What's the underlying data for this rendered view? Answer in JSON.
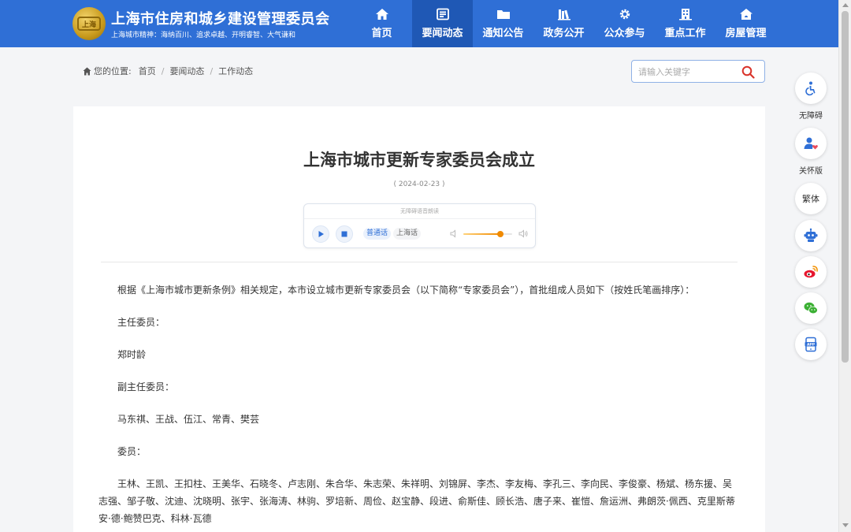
{
  "header": {
    "logo_text": "上海",
    "title": "上海市住房和城乡建设管理委员会",
    "slogan": "上海城市精神：海纳百川、追求卓越、开明睿智、大气谦和",
    "nav": [
      {
        "label": "首页",
        "icon": "home-icon",
        "active": false
      },
      {
        "label": "要闻动态",
        "icon": "news-icon",
        "active": true
      },
      {
        "label": "通知公告",
        "icon": "folder-icon",
        "active": false
      },
      {
        "label": "政务公开",
        "icon": "books-icon",
        "active": false
      },
      {
        "label": "公众参与",
        "icon": "gear-icon",
        "active": false
      },
      {
        "label": "重点工作",
        "icon": "building-icon",
        "active": false
      },
      {
        "label": "房屋管理",
        "icon": "house-icon",
        "active": false
      }
    ],
    "color": "#2f6fd6",
    "active_color": "#1f58b5"
  },
  "breadcrumb": {
    "prefix": "您的位置:",
    "items": [
      "首页",
      "要闻动态",
      "工作动态"
    ],
    "separator": "/"
  },
  "search": {
    "placeholder": "请输入关键字",
    "value": "",
    "icon": "search-icon",
    "icon_color": "#d9342b"
  },
  "article": {
    "title": "上海市城市更新专家委员会成立",
    "date": "( 2024-02-23 )",
    "player": {
      "heading": "无障碍语音朗读",
      "lang_options": [
        "普通话",
        "上海话"
      ],
      "selected_lang": "普通话",
      "volume": 0.75
    },
    "paragraphs": [
      "根据《上海市城市更新条例》相关规定，本市设立城市更新专家委员会（以下简称“专家委员会”），首批组成人员如下（按姓氏笔画排序）：",
      "主任委员：",
      "郑时龄",
      "副主任委员：",
      "马东祺、王战、伍江、常青、樊芸",
      "委员：",
      "王林、王凯、王扣柱、王美华、石晓冬、卢志刚、朱合华、朱志荣、朱祥明、刘锦屏、李杰、李友梅、李孔三、李向民、李俊豪、杨斌、杨东援、吴志强、邹子敬、沈迪、沈晓明、张宇、张海涛、林驹、罗培新、周俭、赵宝静、段进、俞斯佳、顾长浩、唐子来、崔愷、詹运洲、弗朗茨·佩西、克里斯蒂安·德·鲍赞巴克、科林·瓦德"
    ]
  },
  "side_tools": [
    {
      "label": "无障碍",
      "icon": "accessibility-icon"
    },
    {
      "label": "关怀版",
      "icon": "care-mode-icon"
    },
    {
      "label": "繁体",
      "icon": "traditional-chinese-text"
    },
    {
      "label": "",
      "icon": "robot-icon"
    },
    {
      "label": "",
      "icon": "weibo-icon"
    },
    {
      "label": "",
      "icon": "wechat-icon"
    },
    {
      "label": "",
      "icon": "app-icon"
    }
  ]
}
